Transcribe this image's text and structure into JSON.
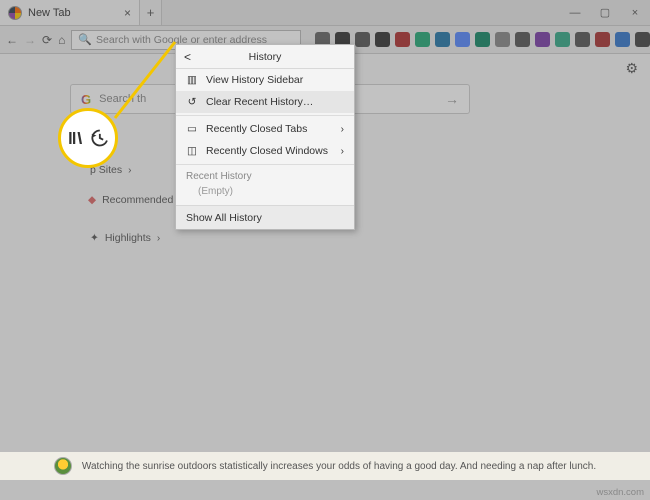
{
  "tab": {
    "title": "New Tab"
  },
  "address_bar": {
    "placeholder": "Search with Google or enter address"
  },
  "content": {
    "search_placeholder": "Search th",
    "top_sites": "p Sites",
    "recommended": "Recommended b",
    "highlights": "Highlights"
  },
  "popup": {
    "title": "History",
    "items": {
      "view_sidebar": "View History Sidebar",
      "clear_recent": "Clear Recent History…",
      "closed_tabs": "Recently Closed Tabs",
      "closed_windows": "Recently Closed Windows"
    },
    "recent_header": "Recent History",
    "recent_empty": "(Empty)",
    "show_all": "Show All History"
  },
  "snippet": {
    "text": "Watching the sunrise outdoors statistically increases your odds of having a good day. And needing a nap after lunch."
  },
  "watermark": "wsxdn.com",
  "ext_colors": [
    "#666",
    "#333",
    "#555",
    "#333",
    "#b03030",
    "#2a7",
    "#27a",
    "#58f",
    "#186",
    "#888",
    "#555",
    "#7a3da8",
    "#3a8",
    "#555",
    "#a33",
    "#37c",
    "#444"
  ]
}
